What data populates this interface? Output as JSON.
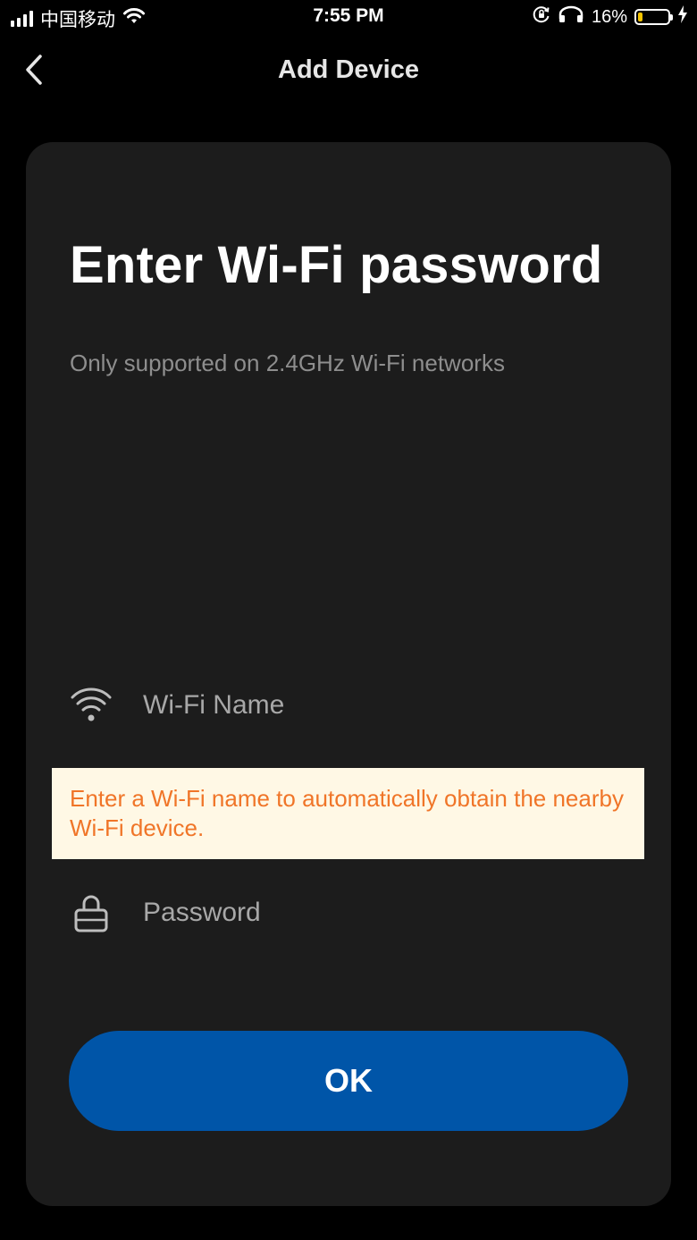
{
  "status_bar": {
    "carrier": "中国移动",
    "time": "7:55 PM",
    "battery_percent": "16%",
    "battery_level": 0.16,
    "icons": [
      "signal-icon",
      "wifi-icon",
      "rotation-lock-icon",
      "headphones-icon",
      "battery-icon",
      "charging-icon"
    ]
  },
  "nav": {
    "title": "Add Device",
    "back_icon": "chevron-left-icon"
  },
  "form": {
    "heading": "Enter Wi-Fi password",
    "subheading": "Only supported on 2.4GHz Wi-Fi networks",
    "wifi_name": {
      "icon": "wifi-icon",
      "value": "",
      "placeholder": "Wi-Fi Name"
    },
    "tooltip": "Enter a Wi-Fi name to automatically obtain the nearby Wi-Fi device.",
    "password": {
      "icon": "lock-icon",
      "value": "",
      "placeholder": "Password"
    },
    "ok_label": "OK"
  },
  "colors": {
    "background": "#000000",
    "card": "#1c1c1c",
    "primary_button": "#0055a8",
    "tooltip_background": "#fff8e5",
    "tooltip_text": "#f07528",
    "battery_fill": "#f5c400"
  }
}
